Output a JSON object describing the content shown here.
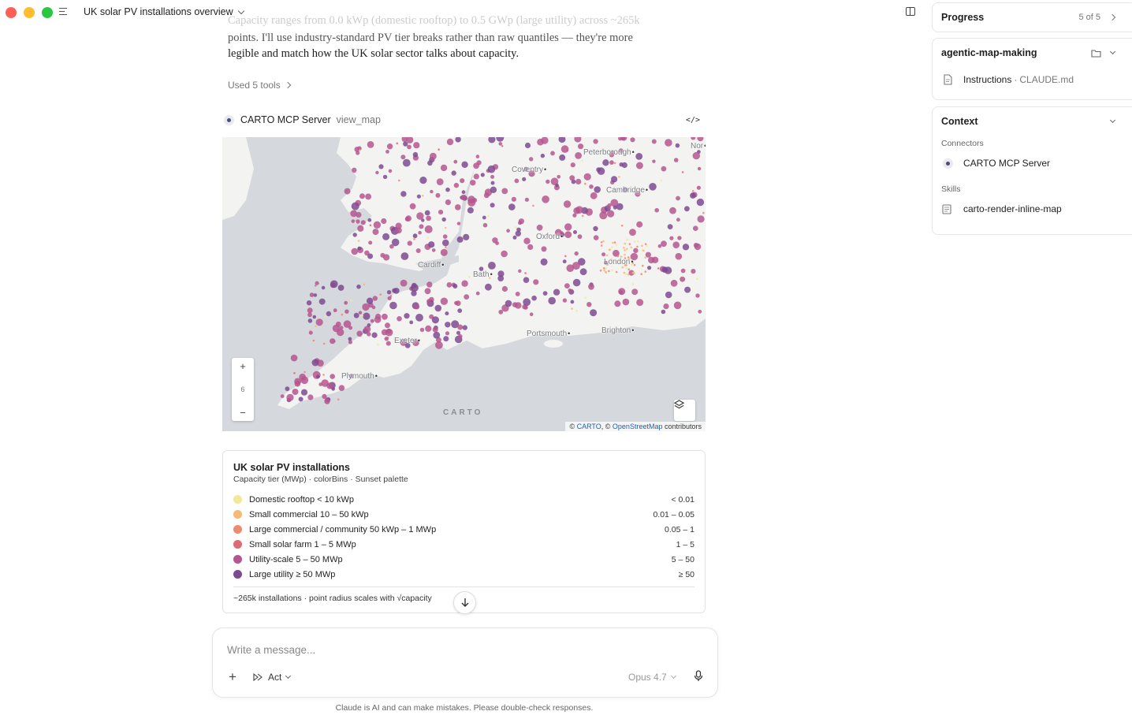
{
  "window": {
    "title": "UK solar PV installations overview"
  },
  "message": {
    "line0": "Capacity ranges from 0.0 kWp (domestic rooftop) to 0.5 GWp (large utility) across ~265k",
    "line1": "points. I'll use industry-standard PV tier breaks rather than raw quantiles — they're more",
    "line2": "legible and match how the UK solar sector talks about capacity.",
    "used_tools": "Used 5 tools"
  },
  "tool_call": {
    "server": "CARTO MCP Server",
    "function": "view_map",
    "code_icon": "</>"
  },
  "map": {
    "zoom_in": "+",
    "zoom_level": "6",
    "zoom_out": "−",
    "logo": "CARTO",
    "attribution_prefix": "© ",
    "attribution_carto": "CARTO",
    "attribution_mid": ", © ",
    "attribution_osm": "OpenStreetMap",
    "attribution_suffix": " contributors",
    "cities": [
      "Peterborough",
      "Coventry",
      "Cambridge",
      "Oxford",
      "London",
      "Cardiff",
      "Bath",
      "Portsmouth",
      "Brighton",
      "Exeter",
      "Plymouth",
      "Nor"
    ],
    "colors": {
      "sea": "#d5d8dc",
      "land": "#f3f3f1",
      "point_mid": "#b5568e",
      "point_large": "#6b3e8f"
    }
  },
  "legend": {
    "title": "UK solar PV installations",
    "subtitle": "Capacity tier (MWp) · colorBins · Sunset palette",
    "rows": [
      {
        "label": "Domestic rooftop < 10 kWp",
        "range": "< 0.01",
        "color": "#f3e79b"
      },
      {
        "label": "Small commercial 10 – 50 kWp",
        "range": "0.01 – 0.05",
        "color": "#f5b978"
      },
      {
        "label": "Large commercial / community 50 kWp – 1 MWp",
        "range": "0.05 – 1",
        "color": "#ef8a70"
      },
      {
        "label": "Small solar farm 1 – 5 MWp",
        "range": "1 – 5",
        "color": "#dc6b73"
      },
      {
        "label": "Utility-scale 5 – 50 MWp",
        "range": "5 – 50",
        "color": "#b5568e"
      },
      {
        "label": "Large utility ≥ 50 MWp",
        "range": "≥ 50",
        "color": "#7c4a92"
      }
    ],
    "footer": "~265k installations · point radius scales with √capacity"
  },
  "composer": {
    "placeholder": "Write a message...",
    "mode": "Act",
    "model": "Opus 4.7"
  },
  "disclaimer": "Claude is AI and can make mistakes. Please double-check responses.",
  "right_panel": {
    "progress": {
      "title": "Progress",
      "count": "5 of 5"
    },
    "project": {
      "title": "agentic-map-making",
      "file_label": "Instructions",
      "file_name": "CLAUDE.md"
    },
    "context": {
      "title": "Context",
      "connectors_label": "Connectors",
      "connector": "CARTO MCP Server",
      "skills_label": "Skills",
      "skill": "carto-render-inline-map"
    }
  }
}
